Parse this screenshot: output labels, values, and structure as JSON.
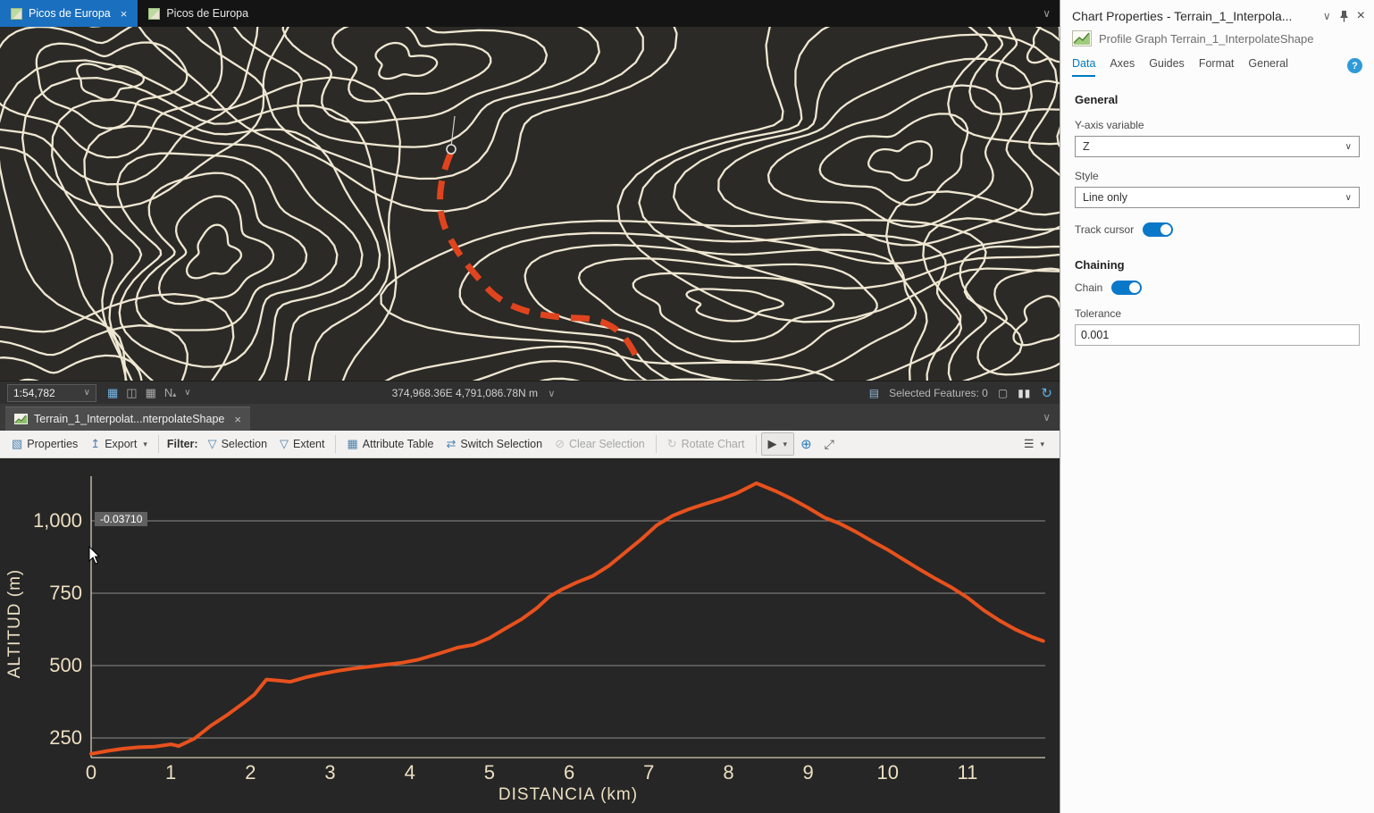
{
  "window": {
    "view_tabs": [
      {
        "label": "Picos de Europa"
      },
      {
        "label": "Picos de Europa"
      }
    ]
  },
  "map_statusbar": {
    "scale": "1:54,782",
    "coordinates": "374,968.36E 4,791,086.78N m",
    "selected_features": "Selected Features: 0",
    "north_label": "N"
  },
  "chart_view": {
    "tab_label": "Terrain_1_Interpolat...nterpolateShape"
  },
  "chart_toolbar": {
    "properties": "Properties",
    "export": "Export",
    "filter_label": "Filter:",
    "selection": "Selection",
    "extent": "Extent",
    "attribute_table": "Attribute Table",
    "switch_selection": "Switch Selection",
    "clear_selection": "Clear Selection",
    "rotate_chart": "Rotate Chart"
  },
  "chart_data": {
    "type": "line",
    "title": "",
    "xlabel": "DISTANCIA (km)",
    "ylabel": "ALTITUD (m)",
    "x": [
      0,
      0.2,
      0.4,
      0.6,
      0.8,
      1,
      1.1,
      1.3,
      1.5,
      1.7,
      1.9,
      2.05,
      2.2,
      2.35,
      2.5,
      2.7,
      2.9,
      3.1,
      3.3,
      3.6,
      3.9,
      4.1,
      4.35,
      4.6,
      4.8,
      5,
      5.2,
      5.4,
      5.6,
      5.75,
      5.9,
      6.1,
      6.3,
      6.5,
      6.7,
      6.9,
      7.1,
      7.3,
      7.5,
      7.7,
      7.9,
      8.1,
      8.35,
      8.6,
      8.8,
      9,
      9.2,
      9.4,
      9.6,
      9.8,
      10,
      10.2,
      10.4,
      10.6,
      10.8,
      11,
      11.2,
      11.4,
      11.6,
      11.8,
      11.95
    ],
    "y": [
      195,
      205,
      213,
      218,
      220,
      228,
      222,
      248,
      292,
      328,
      368,
      400,
      452,
      448,
      444,
      460,
      472,
      482,
      490,
      500,
      510,
      520,
      540,
      562,
      572,
      595,
      628,
      660,
      700,
      738,
      762,
      788,
      810,
      845,
      890,
      935,
      985,
      1018,
      1040,
      1058,
      1075,
      1095,
      1130,
      1102,
      1075,
      1045,
      1012,
      990,
      962,
      930,
      900,
      866,
      832,
      800,
      770,
      735,
      692,
      656,
      625,
      600,
      585
    ],
    "xticks": [
      0,
      1,
      2,
      3,
      4,
      5,
      6,
      7,
      8,
      9,
      10,
      11
    ],
    "yticks": [
      250,
      500,
      750,
      1000
    ],
    "ytick_labels": [
      "250",
      "500",
      "750",
      "1,000"
    ],
    "xlim": [
      0,
      12.1
    ],
    "ylim": [
      180,
      1150
    ],
    "grid": "horizontal-only",
    "legend": "none",
    "line_color": "#e8511d",
    "cursor_readout": "-0.03710"
  },
  "chart_properties": {
    "title": "Chart Properties - Terrain_1_Interpola...",
    "subtitle": "Profile Graph Terrain_1_InterpolateShape",
    "tabs": [
      "Data",
      "Axes",
      "Guides",
      "Format",
      "General"
    ],
    "active_tab": "Data",
    "general_heading": "General",
    "y_axis_variable_label": "Y-axis variable",
    "y_axis_variable_value": "Z",
    "style_label": "Style",
    "style_value": "Line only",
    "track_cursor_label": "Track cursor",
    "chaining_heading": "Chaining",
    "chain_label": "Chain",
    "tolerance_label": "Tolerance",
    "tolerance_value": "0.001"
  },
  "icons": {
    "chevron_down": "∨",
    "dropdown": "▾",
    "close": "×",
    "help": "?",
    "pause": "▮▮",
    "refresh": "↻",
    "menu": "☰",
    "properties": "▧",
    "export": "↥",
    "filter": "▽",
    "table": "▦",
    "switch": "⇄",
    "clear": "⊘",
    "rotate": "↻",
    "pointer": "▶",
    "zoom_in": "⊕",
    "full_extent": "⤢",
    "grid_blue": "▦",
    "grid_gray": "◫",
    "selected": "▤",
    "clear_box": "▢",
    "north_arrow": "▴"
  },
  "colors": {
    "accent_blue": "#1a6fbf",
    "panel_blue": "#0079c1",
    "chart_line": "#e8511d",
    "contour": "#efe7d2",
    "map_bg": "#2b2a26",
    "chart_bg": "#262626",
    "profile_line_red": "#e0441e"
  }
}
